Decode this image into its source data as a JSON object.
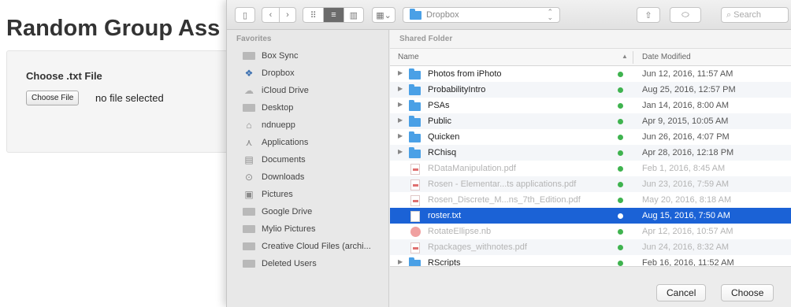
{
  "page": {
    "title": "Random Group Ass",
    "file_label": "Choose .txt File",
    "choose_button": "Choose File",
    "no_file_text": "no file selected"
  },
  "dialog": {
    "location": "Dropbox",
    "search_placeholder": "Search",
    "sidebar": {
      "header": "Favorites",
      "items": [
        {
          "label": "Box Sync",
          "icon": "folder-icon"
        },
        {
          "label": "Dropbox",
          "icon": "dropbox-icon"
        },
        {
          "label": "iCloud Drive",
          "icon": "cloud-icon"
        },
        {
          "label": "Desktop",
          "icon": "folder-icon"
        },
        {
          "label": "ndnuepp",
          "icon": "home-icon"
        },
        {
          "label": "Applications",
          "icon": "applications-icon"
        },
        {
          "label": "Documents",
          "icon": "document-icon"
        },
        {
          "label": "Downloads",
          "icon": "download-icon"
        },
        {
          "label": "Pictures",
          "icon": "camera-icon"
        },
        {
          "label": "Google Drive",
          "icon": "folder-icon"
        },
        {
          "label": "Mylio Pictures",
          "icon": "folder-icon"
        },
        {
          "label": "Creative Cloud Files (archi...",
          "icon": "folder-icon"
        },
        {
          "label": "Deleted Users",
          "icon": "folder-icon"
        }
      ]
    },
    "content_header": "Shared Folder",
    "columns": {
      "name": "Name",
      "date": "Date Modified"
    },
    "rows": [
      {
        "name": "Photos from iPhoto",
        "date": "Jun 12, 2016, 11:57 AM"
      },
      {
        "name": "ProbabilityIntro",
        "date": "Aug 25, 2016, 12:57 PM"
      },
      {
        "name": "PSAs",
        "date": "Jan 14, 2016, 8:00 AM"
      },
      {
        "name": "Public",
        "date": "Apr 9, 2015, 10:05 AM"
      },
      {
        "name": "Quicken",
        "date": "Jun 26, 2016, 4:07 PM"
      },
      {
        "name": "RChisq",
        "date": "Apr 28, 2016, 12:18 PM"
      },
      {
        "name": "RDataManipulation.pdf",
        "date": "Feb 1, 2016, 8:45 AM"
      },
      {
        "name": "Rosen - Elementar...ts applications.pdf",
        "date": "Jun 23, 2016, 7:59 AM"
      },
      {
        "name": "Rosen_Discrete_M...ns_7th_Edition.pdf",
        "date": "May 20, 2016, 8:18 AM"
      },
      {
        "name": "roster.txt",
        "date": "Aug 15, 2016, 7:50 AM"
      },
      {
        "name": "RotateEllipse.nb",
        "date": "Apr 12, 2016, 10:57 AM"
      },
      {
        "name": "Rpackages_withnotes.pdf",
        "date": "Jun 24, 2016, 8:32 AM"
      },
      {
        "name": "RScripts",
        "date": "Feb 16, 2016, 11:52 AM"
      }
    ],
    "cancel_button": "Cancel",
    "choose_button": "Choose"
  },
  "colors": {
    "accent": "#1b62d6",
    "folder": "#4aa0e6",
    "sync": "#3fb34f"
  }
}
